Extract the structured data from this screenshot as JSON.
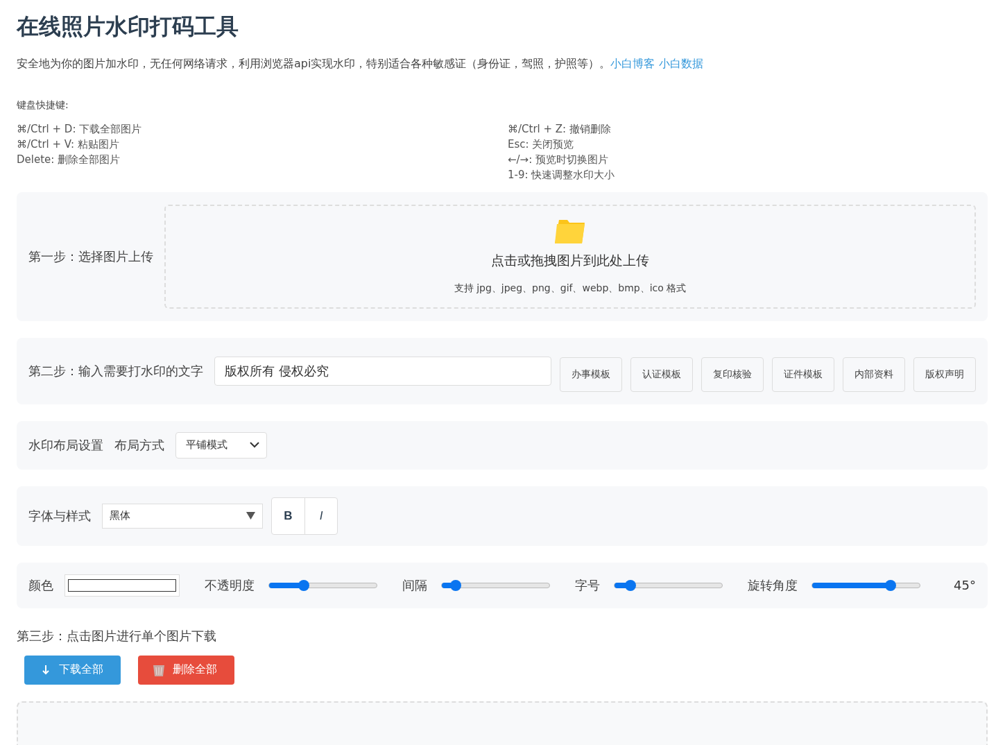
{
  "title": "在线照片水印打码工具",
  "intro": {
    "text": "安全地为你的图片加水印，无任何网络请求，利用浏览器api实现水印，特别适合各种敏感证（身份证，驾照，护照等）。",
    "links": [
      "小白博客",
      "小白数据"
    ]
  },
  "shortcuts": {
    "heading": "键盘快捷键:",
    "left": [
      "⌘/Ctrl + D: 下载全部图片",
      "⌘/Ctrl + V: 粘贴图片",
      "Delete: 删除全部图片"
    ],
    "right": [
      "⌘/Ctrl + Z: 撤销删除",
      "Esc: 关闭预览",
      "←/→: 预览时切换图片",
      "1-9: 快速调整水印大小"
    ]
  },
  "step1": {
    "label": "第一步：选择图片上传",
    "drop_title": "点击或拖拽图片到此处上传",
    "drop_hint": "支持 jpg、jpeg、png、gif、webp、bmp、ico 格式"
  },
  "step2": {
    "label": "第二步：输入需要打水印的文字",
    "input_value": "版权所有 侵权必究",
    "templates": [
      "办事模板",
      "认证模板",
      "复印核验",
      "证件模板",
      "内部资料",
      "版权声明"
    ]
  },
  "layout": {
    "label": "水印布局设置",
    "mode_label": "布局方式",
    "mode_value": "平铺模式"
  },
  "font": {
    "label": "字体与样式",
    "family_value": "黑体",
    "bold_button": "B",
    "italic_button": "I"
  },
  "sliders": {
    "color_label": "颜色",
    "items": [
      {
        "label": "不透明度",
        "level": 0.32
      },
      {
        "label": "间隔",
        "level": 0.13
      },
      {
        "label": "字号",
        "level": 0.15
      },
      {
        "label": "旋转角度",
        "level": 0.73
      }
    ],
    "rotation_reading": "45°"
  },
  "step3": {
    "label": "第三步：点击图片进行单个图片下载",
    "download_button": "下载全部",
    "delete_button": "删除全部"
  }
}
